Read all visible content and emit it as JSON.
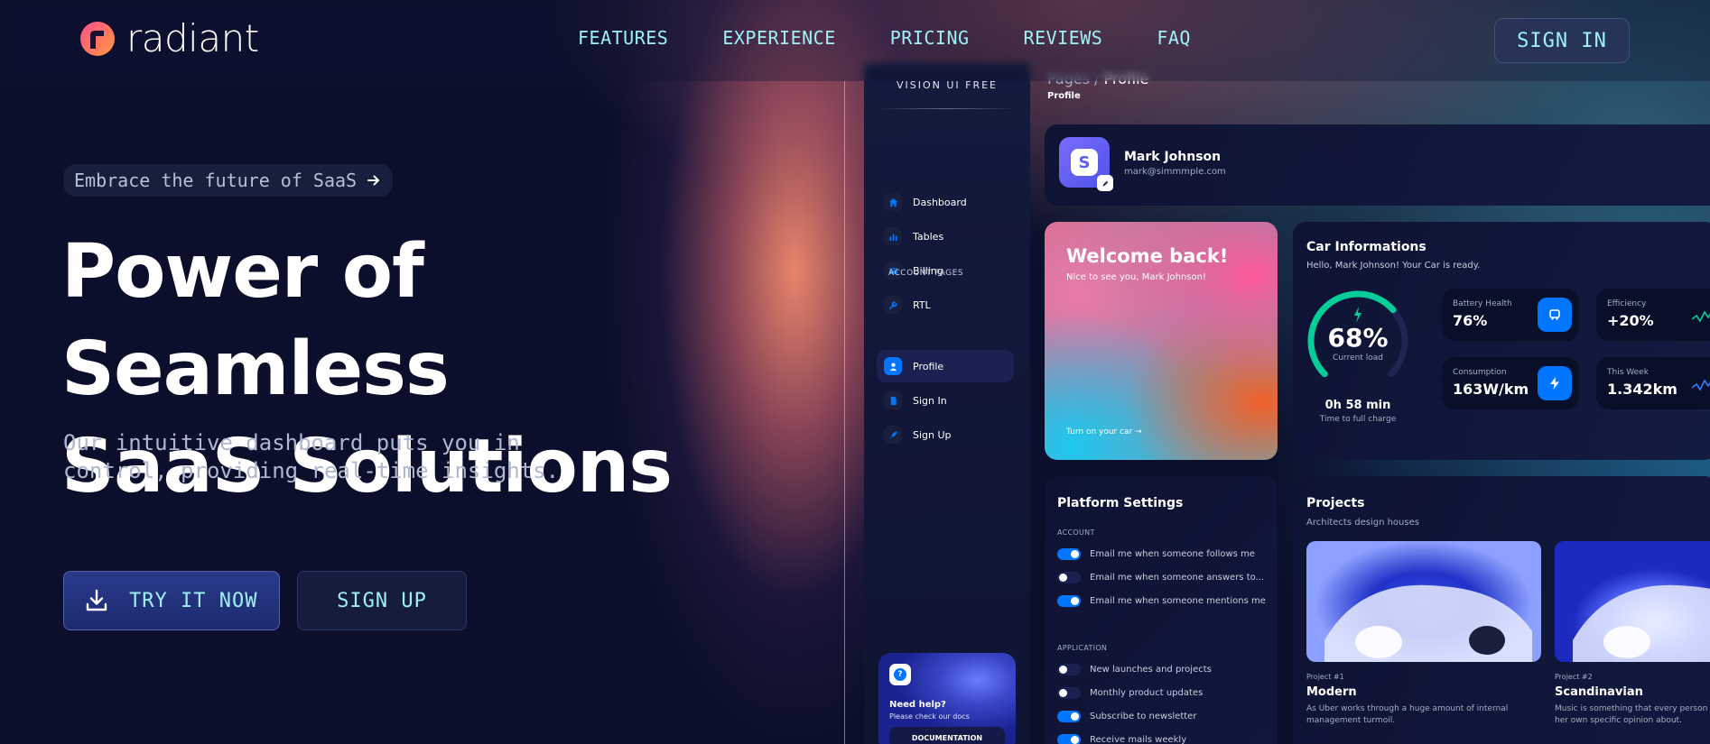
{
  "colors": {
    "accent": "#9ff0f5",
    "primary_blue": "#0075ff",
    "background": "#0b0f2b"
  },
  "nav": {
    "logo_text": "radiant",
    "links": [
      "FEATURES",
      "EXPERIENCE",
      "PRICING",
      "REVIEWS",
      "FAQ"
    ],
    "sign_in": "SIGN IN"
  },
  "hero": {
    "tagline": "Embrace the future of SaaS",
    "title_line1": "Power of Seamless",
    "title_line2": "SaaS Solutions",
    "subtitle_line1": "Our intuitive dashboard puts you in",
    "subtitle_line2": "control, providing real-time insights.",
    "try_button": "TRY IT NOW",
    "signup_button": "SIGN UP"
  },
  "dashboard": {
    "brand": "VISION UI FREE",
    "sidebar": {
      "items": [
        {
          "label": "Dashboard",
          "icon": "home-icon"
        },
        {
          "label": "Tables",
          "icon": "chart-icon"
        },
        {
          "label": "Billing",
          "icon": "card-icon"
        },
        {
          "label": "RTL",
          "icon": "wrench-icon"
        }
      ],
      "section": "ACCOUNT PAGES",
      "account_items": [
        {
          "label": "Profile",
          "icon": "person-icon",
          "active": true
        },
        {
          "label": "Sign In",
          "icon": "document-icon"
        },
        {
          "label": "Sign Up",
          "icon": "rocket-icon"
        }
      ],
      "help": {
        "title": "Need help?",
        "subtitle": "Please check our docs",
        "button": "DOCUMENTATION"
      }
    },
    "breadcrumb": {
      "parent": "Pages",
      "sep": " / ",
      "current": "Profile",
      "page": "Profile"
    },
    "profile": {
      "name": "Mark Johnson",
      "email": "mark@simmmple.com"
    },
    "welcome": {
      "title": "Welcome back!",
      "subtitle": "Nice to see you, Mark Johnson!",
      "link": "Turn on your car →"
    },
    "car": {
      "title": "Car Informations",
      "subtitle": "Hello, Mark Johnson! Your Car is ready.",
      "gauge_value": "68%",
      "gauge_fraction": 0.68,
      "gauge_caption": "Current load",
      "charge_time": "0h 58 min",
      "charge_caption": "Time to full charge",
      "stats": [
        {
          "label": "Battery Health",
          "value": "76%"
        },
        {
          "label": "Efficiency",
          "value": "+20%"
        },
        {
          "label": "Consumption",
          "value": "163W/km"
        },
        {
          "label": "This Week",
          "value": "1.342km"
        }
      ]
    },
    "settings": {
      "title": "Platform Settings",
      "account_caption": "ACCOUNT",
      "account_toggles": [
        {
          "label": "Email me when someone follows me",
          "on": true
        },
        {
          "label": "Email me when someone answers to...",
          "on": false
        },
        {
          "label": "Email me when someone mentions me",
          "on": true
        }
      ],
      "application_caption": "APPLICATION",
      "application_toggles": [
        {
          "label": "New launches and projects",
          "on": false
        },
        {
          "label": "Monthly product updates",
          "on": false
        },
        {
          "label": "Subscribe to newsletter",
          "on": true
        },
        {
          "label": "Receive mails weekly",
          "on": true
        }
      ]
    },
    "projects": {
      "title": "Projects",
      "subtitle": "Architects design houses",
      "items": [
        {
          "num": "Project #1",
          "name": "Modern",
          "desc": "As Uber works through a huge amount of internal management turmoil."
        },
        {
          "num": "Project #2",
          "name": "Scandinavian",
          "desc": "Music is something that every person has his or her own specific opinion about."
        }
      ]
    }
  }
}
